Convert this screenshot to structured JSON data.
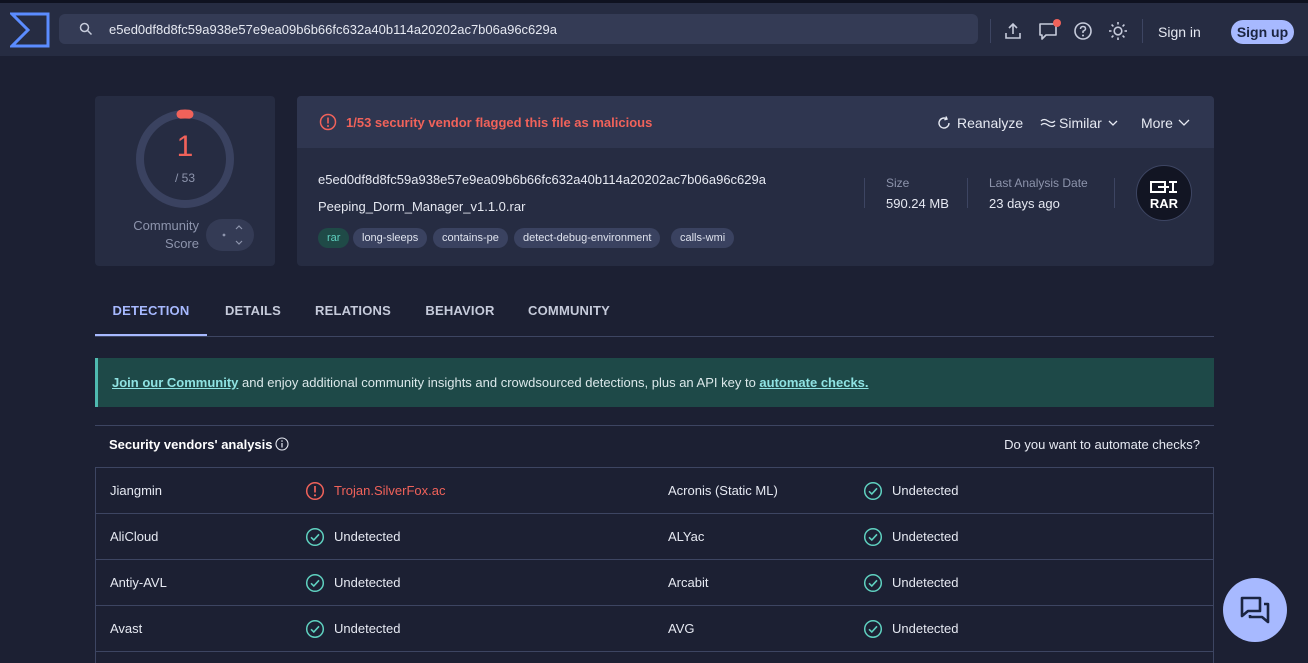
{
  "search": {
    "value": "e5ed0df8d8fc59a938e57e9ea09b6b66fc632a40b114a20202ac7b06a96c629a"
  },
  "header": {
    "sign_in": "Sign in",
    "sign_up": "Sign up",
    "icons": [
      "upload-icon",
      "chat-bubble-icon",
      "help-icon",
      "theme-icon"
    ]
  },
  "score": {
    "detections": "1",
    "total": "/ 53",
    "community_label_1": "Community",
    "community_label_2": "Score"
  },
  "summary": {
    "flag_text": "1/53 security vendor flagged this file as malicious",
    "actions": {
      "reanalyze": "Reanalyze",
      "similar": "Similar",
      "more": "More"
    },
    "hash": "e5ed0df8d8fc59a938e57e9ea09b6b66fc632a40b114a20202ac7b06a96c629a",
    "file_name": "Peeping_Dorm_Manager_v1.1.0.rar",
    "tags": [
      "rar",
      "long-sleeps",
      "contains-pe",
      "detect-debug-environment",
      "calls-wmi"
    ],
    "size_label": "Size",
    "size_value": "590.24 MB",
    "date_label": "Last Analysis Date",
    "date_value": "23 days ago",
    "file_type": "RAR"
  },
  "tabs": [
    "DETECTION",
    "DETAILS",
    "RELATIONS",
    "BEHAVIOR",
    "COMMUNITY"
  ],
  "banner": {
    "link1": "Join our Community",
    "middle": " and enjoy additional community insights and crowdsourced detections, plus an API key to ",
    "link2": "automate checks."
  },
  "vendors": {
    "title": "Security vendors' analysis",
    "automate": "Do you want to automate checks?",
    "rows": [
      {
        "left": {
          "name": "Jiangmin",
          "result": "Trojan.SilverFox.ac",
          "malicious": true
        },
        "right": {
          "name": "Acronis (Static ML)",
          "result": "Undetected"
        }
      },
      {
        "left": {
          "name": "AliCloud",
          "result": "Undetected"
        },
        "right": {
          "name": "ALYac",
          "result": "Undetected"
        }
      },
      {
        "left": {
          "name": "Antiy-AVL",
          "result": "Undetected"
        },
        "right": {
          "name": "Arcabit",
          "result": "Undetected"
        }
      },
      {
        "left": {
          "name": "Avast",
          "result": "Undetected"
        },
        "right": {
          "name": "AVG",
          "result": "Undetected"
        }
      }
    ]
  },
  "colors": {
    "accent": "#a7b9ff",
    "malicious": "#f0625a",
    "clean": "#5fd1c0"
  }
}
